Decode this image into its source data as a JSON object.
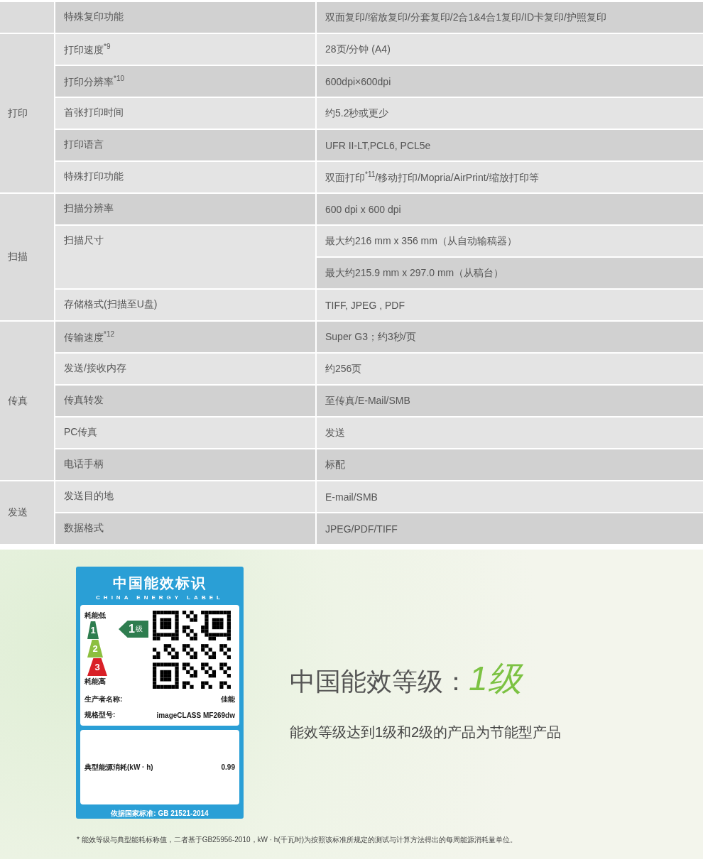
{
  "spec_table": {
    "groups": [
      {
        "rows": [
          {
            "label": "特殊复印功能",
            "values": [
              "双面复印/缩放复印/分套复印/2合1&4合1复印/ID卡复印/护照复印"
            ]
          }
        ]
      },
      {
        "category": "打印",
        "rows": [
          {
            "label": "打印速度$^{*9}$",
            "values": [
              "28页/分钟 (A4)"
            ]
          },
          {
            "label": "打印分辨率$^{*10}$",
            "values": [
              "600dpi×600dpi"
            ]
          },
          {
            "label": "首张打印时间",
            "values": [
              "约5.2秒或更少"
            ]
          },
          {
            "label": "打印语言",
            "values": [
              "UFR II-LT,PCL6, PCL5e"
            ]
          },
          {
            "label": "特殊打印功能",
            "values": [
              "双面打印$^{*11}$/移动打印/Mopria/AirPrint/缩放打印等"
            ]
          }
        ]
      },
      {
        "category": "扫描",
        "rows": [
          {
            "label": "扫描分辨率",
            "values": [
              "600 dpi x 600 dpi"
            ]
          },
          {
            "label": "扫描尺寸",
            "values": [
              "最大约216 mm x 356 mm（从自动输稿器）",
              "最大约215.9 mm x 297.0 mm（从稿台）"
            ]
          },
          {
            "label": "存储格式(扫描至U盘)",
            "values": [
              "TIFF, JPEG , PDF"
            ]
          }
        ]
      },
      {
        "category": "传真",
        "rows": [
          {
            "label": "传输速度$^{*12}$",
            "values": [
              "Super G3；约3秒/页"
            ]
          },
          {
            "label": "发送/接收内存",
            "values": [
              "约256页"
            ]
          },
          {
            "label": "传真转发",
            "values": [
              "至传真/E-Mail/SMB"
            ]
          },
          {
            "label": "PC传真",
            "values": [
              "发送"
            ]
          },
          {
            "label": "电话手柄",
            "values": [
              "标配"
            ]
          }
        ]
      },
      {
        "category": "发送",
        "rows": [
          {
            "label": "发送目的地",
            "values": [
              "E-mail/SMB"
            ]
          },
          {
            "label": "数据格式",
            "values": [
              "JPEG/PDF/TIFF"
            ]
          }
        ]
      }
    ]
  },
  "energy_label": {
    "title": "中国能效标识",
    "subtitle": "CHINA ENERGY LABEL",
    "low_label": "耗能低",
    "high_label": "耗能高",
    "grades": [
      {
        "text": "1",
        "color": "#2e7d4f"
      },
      {
        "text": "2",
        "color": "#8cbf3f"
      },
      {
        "text": "3",
        "color": "#d92027"
      }
    ],
    "grade_arrow": {
      "number": "1",
      "unit": "级"
    },
    "fields": [
      {
        "label": "生产者名称:",
        "value": "佳能"
      },
      {
        "label": "规格型号:",
        "value": "imageCLASS MF269dw"
      }
    ],
    "consumption": {
      "label": "典型能源消耗(kW · h)",
      "value": "0.99"
    },
    "standard": "依据国家标准: GB 21521-2014"
  },
  "energy_heading": {
    "text": "中国能效等级：",
    "grade": "1级"
  },
  "energy_note": "能效等级达到1级和2级的产品为节能型产品",
  "footnote": "* 能效等级与典型能耗标称值，二者基于GB25956-2010，kW · h(千瓦时)为按照该标准所规定的测试与计算方法得出的每周能源消耗量单位。"
}
